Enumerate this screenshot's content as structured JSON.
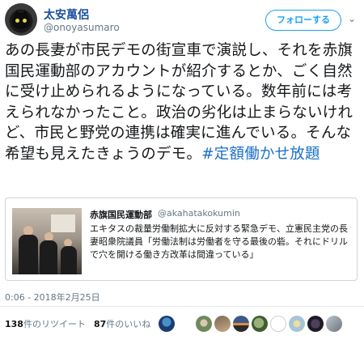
{
  "tweet": {
    "author": {
      "display_name": "太安萬侶",
      "handle": "@onoyasumaro",
      "avatar_icon": "black-cat-avatar"
    },
    "follow_label": "フォローする",
    "text_main": "あの長妻が市民デモの街宣車で演説し、それを赤旗国民運動部のアカウントが紹介するとか、ごく自然に受け止められるようになっている。数年前には考えられなかったこと。政治の劣化は止まらないけれど、市民と野党の連携は確実に進んでいる。そんな希望も見えたきょうのデモ。",
    "hashtag": "#定額働かせ放題",
    "quote": {
      "author": "赤旗国民運動部",
      "handle": "@akahatakokumin",
      "body": "エキタスの裁量労働制拡大に反対する緊急デモ、立憲民主党の長妻昭衆院議員「労働法制は労働者を守る最後の砦。それにドリルで穴を開ける働き方改革は間違っている」"
    },
    "timestamp": "0:06 - 2018年2月25日",
    "stats": {
      "retweets_count": "138",
      "retweets_label": "件のリツイート",
      "likes_count": "87",
      "likes_label": "件のいいね"
    },
    "likers": [
      "liker-avatar-1",
      "liker-avatar-2",
      "liker-avatar-3",
      "liker-avatar-4",
      "liker-avatar-5",
      "liker-avatar-6",
      "liker-avatar-7",
      "liker-avatar-8",
      "liker-avatar-9",
      "liker-avatar-10"
    ]
  },
  "colors": {
    "name": "#1a4fa0",
    "link": "#1a6fc9",
    "follow": "#1da1f2",
    "muted": "#657786"
  }
}
